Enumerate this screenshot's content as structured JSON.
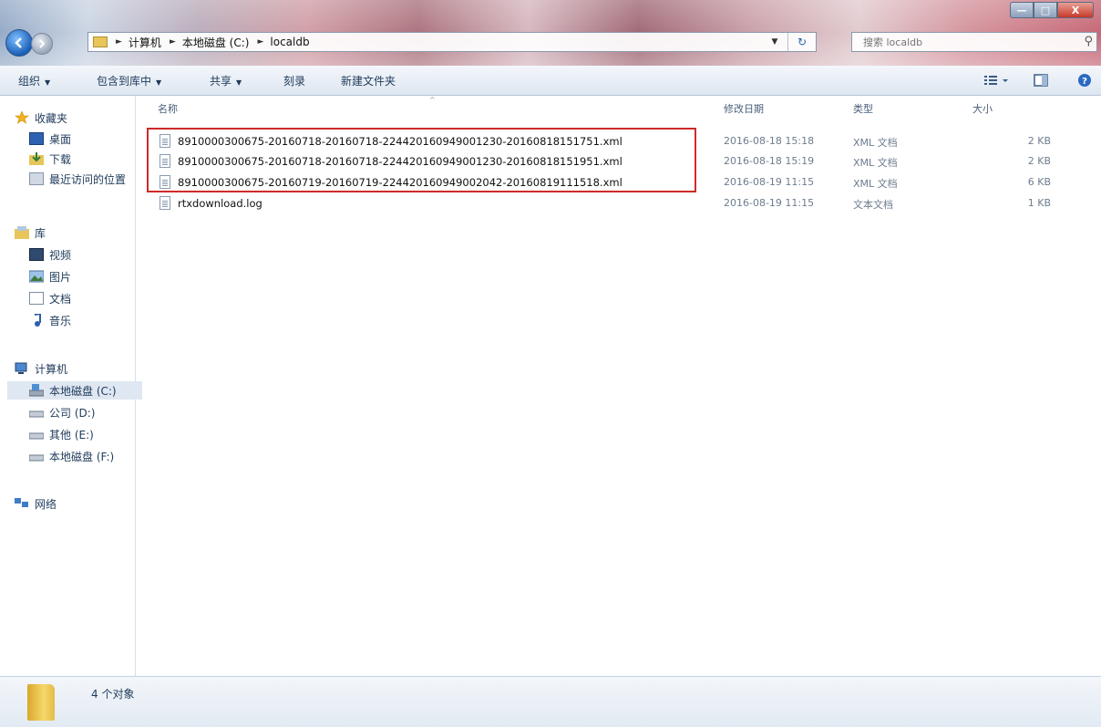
{
  "window": {
    "minimize_label": "—",
    "maximize_label": "□",
    "close_label": "X"
  },
  "address_bar": {
    "breadcrumbs": [
      "计算机",
      "本地磁盘 (C:)",
      "localdb"
    ],
    "refresh_label": "↻"
  },
  "search": {
    "placeholder": "搜索 localdb"
  },
  "toolbar": {
    "organize": "组织",
    "include_in_library": "包含到库中",
    "share": "共享",
    "burn": "刻录",
    "new_folder": "新建文件夹"
  },
  "sidebar": {
    "favorites": "收藏夹",
    "desktop": "桌面",
    "downloads": "下载",
    "recent": "最近访问的位置",
    "libraries": "库",
    "videos": "视频",
    "pictures": "图片",
    "documents": "文档",
    "music": "音乐",
    "computer": "计算机",
    "drive_c": "本地磁盘 (C:)",
    "drive_d": "公司 (D:)",
    "drive_e": "其他 (E:)",
    "drive_f": "本地磁盘 (F:)",
    "network": "网络"
  },
  "columns": {
    "name": "名称",
    "date_modified": "修改日期",
    "type": "类型",
    "size": "大小"
  },
  "files": [
    {
      "name": "8910000300675-20160718-20160718-2244201609490012​30-20160818151751.xml",
      "date": "2016-08-18 15:18",
      "type": "XML 文档",
      "size": "2 KB"
    },
    {
      "name": "8910000300675-20160718-20160718-224420160949001230-20160818151951.xml",
      "date": "2016-08-18 15:19",
      "type": "XML 文档",
      "size": "2 KB"
    },
    {
      "name": "8910000300675-20160719-20160719-224420160949002042-20160819111518.xml",
      "date": "2016-08-19 11:15",
      "type": "XML 文档",
      "size": "6 KB"
    },
    {
      "name": "rtxdownload.log",
      "date": "2016-08-19 11:15",
      "type": "文本文档",
      "size": "1 KB"
    }
  ],
  "status": {
    "item_count": "4 个对象"
  },
  "colors": {
    "highlight_border": "#cf2a2a",
    "toolbar_bg": "#dde6f1",
    "nav_text": "#1e3a5a"
  }
}
